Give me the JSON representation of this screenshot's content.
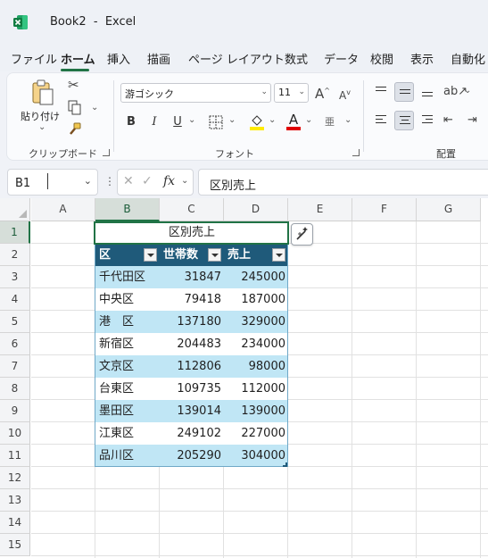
{
  "window": {
    "title": "Book2  -  Excel"
  },
  "menu": {
    "tabs": [
      {
        "label": "ファイル"
      },
      {
        "label": "ホーム"
      },
      {
        "label": "挿入"
      },
      {
        "label": "描画"
      },
      {
        "label": "ページ レイアウト"
      },
      {
        "label": "数式"
      },
      {
        "label": "データ"
      },
      {
        "label": "校閲"
      },
      {
        "label": "表示"
      },
      {
        "label": "自動化"
      }
    ],
    "active": "ホーム"
  },
  "ribbon": {
    "clipboard": {
      "paste_label": "貼り付け",
      "group_label": "クリップボード"
    },
    "font": {
      "font_name": "游ゴシック",
      "font_size": "11",
      "group_label": "フォント",
      "bold": "B",
      "italic": "I",
      "underline": "U",
      "grow": "A",
      "shrink": "A",
      "font_color_letter": "A",
      "phonetic": "亜"
    },
    "alignment": {
      "group_label": "配置"
    }
  },
  "formula_bar": {
    "name_box": "B1",
    "fx_label": "fx",
    "formula": "区別売上"
  },
  "sheet": {
    "columns": [
      "A",
      "B",
      "C",
      "D",
      "E",
      "F",
      "G"
    ],
    "selected_column": "B",
    "rows": [
      "1",
      "2",
      "3",
      "4",
      "5",
      "6",
      "7",
      "8",
      "9",
      "10",
      "11",
      "12",
      "13",
      "14",
      "15"
    ],
    "selected_row": "1",
    "b1_title": "区別売上",
    "table_headers": [
      "区",
      "世帯数",
      "売上"
    ],
    "table_rows": [
      {
        "ward": "千代田区",
        "households": "31847",
        "sales": "245000"
      },
      {
        "ward": "中央区",
        "households": "79418",
        "sales": "187000"
      },
      {
        "ward": "港　区",
        "households": "137180",
        "sales": "329000"
      },
      {
        "ward": "新宿区",
        "households": "204483",
        "sales": "234000"
      },
      {
        "ward": "文京区",
        "households": "112806",
        "sales": "98000"
      },
      {
        "ward": "台東区",
        "households": "109735",
        "sales": "112000"
      },
      {
        "ward": "墨田区",
        "households": "139014",
        "sales": "139000"
      },
      {
        "ward": "江東区",
        "households": "249102",
        "sales": "227000"
      },
      {
        "ward": "品川区",
        "households": "205290",
        "sales": "304000"
      }
    ]
  },
  "colors": {
    "accent": "#217346",
    "table_header": "#1f5a7a",
    "table_band": "#c0e6f5"
  }
}
